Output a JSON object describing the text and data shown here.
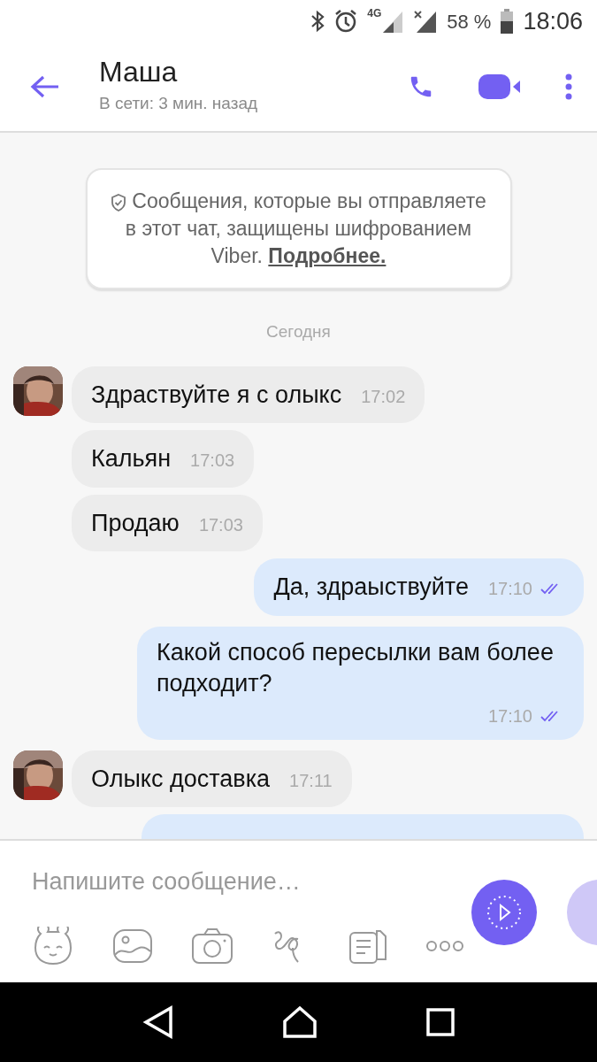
{
  "status_bar": {
    "network_1": "4G",
    "battery": "58 %",
    "time": "18:06"
  },
  "header": {
    "name": "Маша",
    "presence": "В сети: 3 мин. назад"
  },
  "notice": {
    "text": "Сообщения, которые вы отправляете в этот чат, защищены шифрованием Viber.",
    "link": "Подробнее."
  },
  "date_divider": "Сегодня",
  "messages": [
    {
      "kind": "incoming",
      "avatar": true,
      "text": "Здраствуйте я с олыкс",
      "time": "17:02"
    },
    {
      "kind": "incoming",
      "avatar": false,
      "text": "Кальян",
      "time": "17:03"
    },
    {
      "kind": "incoming",
      "avatar": false,
      "text": "Продаю",
      "time": "17:03"
    },
    {
      "kind": "outgoing",
      "read": true,
      "text": "Да, здраыствуйте",
      "time": "17:10"
    },
    {
      "kind": "outgoing",
      "read": true,
      "text": "Какой способ пересылки вам более подходит?",
      "time": "17:10"
    },
    {
      "kind": "incoming",
      "avatar": true,
      "text": "Олыкс доставка",
      "time": "17:11"
    },
    {
      "kind": "clipped"
    }
  ],
  "composer": {
    "placeholder": "Напишите сообщение…"
  }
}
